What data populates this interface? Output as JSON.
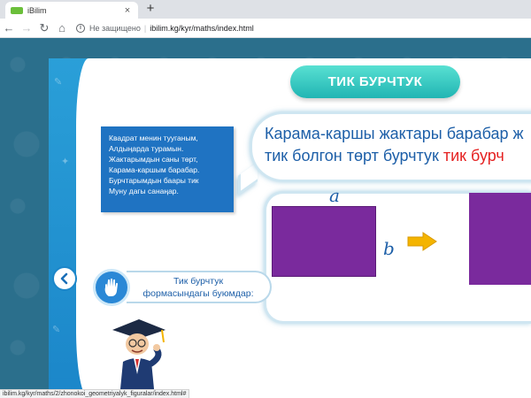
{
  "browser": {
    "tab_title": "iBilim",
    "tab_close": "×",
    "new_tab": "+",
    "nav": {
      "back": "←",
      "forward": "→",
      "reload": "↻",
      "home": "⌂"
    },
    "security_label": "Не защищено",
    "url": "ibilim.kg/kyr/maths/index.html",
    "status_url": "ibilim.kg/kyr/maths/2/zhonokoi_geometriyalyk_figuralar/index.html#"
  },
  "lesson": {
    "title": "ТИК БУРЧТУК",
    "poem": [
      "Квадрат менин тууганым,",
      "Алдыңарда турамын.",
      "Жактарымдын саны төрт,",
      "Карама-каршым барабар.",
      "Бурчтарымдын баары тик",
      "Муну дагы санаңар."
    ],
    "definition_line1": "Карама-каршы жактары барабар ж",
    "definition_line2_plain": "тик болгон төрт бурчтук ",
    "definition_line2_highlight": "тик бурч",
    "side_a": "a",
    "side_b": "b",
    "caption_line1": "Тик бурчтук",
    "caption_line2": "формасындагы буюмдар:"
  },
  "colors": {
    "accent_teal": "#21b5b3",
    "text_blue": "#1d5fa8",
    "highlight_red": "#e52222",
    "shape_purple": "#7a2a9d",
    "arrow_yellow": "#f4b400"
  },
  "icons": [
    "favicon-icon",
    "info-icon",
    "arrow-right-icon",
    "chevron-left-icon",
    "hand-icon"
  ]
}
